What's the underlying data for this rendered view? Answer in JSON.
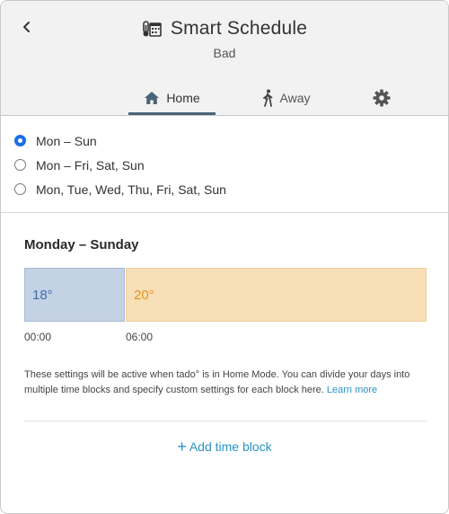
{
  "header": {
    "title": "Smart Schedule",
    "subtitle": "Bad",
    "icons": {
      "back": "chevron-left-icon",
      "title": "thermometer-calendar-icon"
    }
  },
  "tabs": [
    {
      "label": "Home",
      "icon": "home-icon",
      "active": true
    },
    {
      "label": "Away",
      "icon": "walking-person-icon",
      "active": false
    },
    {
      "label": "",
      "icon": "gear-icon",
      "active": false
    }
  ],
  "schedule_options": [
    {
      "label": "Mon – Sun",
      "selected": true
    },
    {
      "label": "Mon – Fri, Sat, Sun",
      "selected": false
    },
    {
      "label": "Mon, Tue, Wed, Thu, Fri, Sat, Sun",
      "selected": false
    }
  ],
  "day_group": {
    "title": "Monday – Sunday",
    "blocks": [
      {
        "temperature": "18°",
        "start": "00:00",
        "end": "06:00",
        "color": "#c4d2e5"
      },
      {
        "temperature": "20°",
        "start": "06:00",
        "end": "24:00",
        "color": "#f7dfb8"
      }
    ],
    "time_labels": [
      "00:00",
      "06:00"
    ]
  },
  "info": {
    "text": "These settings will be active when tado° is in Home Mode. You can divide your days into multiple time blocks and specify custom settings for each block here. ",
    "link": "Learn more"
  },
  "add_block_label": "Add time block",
  "colors": {
    "accent": "#2a93c9",
    "tab_underline": "#4a6478",
    "radio_selected": "#1a6fe0"
  }
}
